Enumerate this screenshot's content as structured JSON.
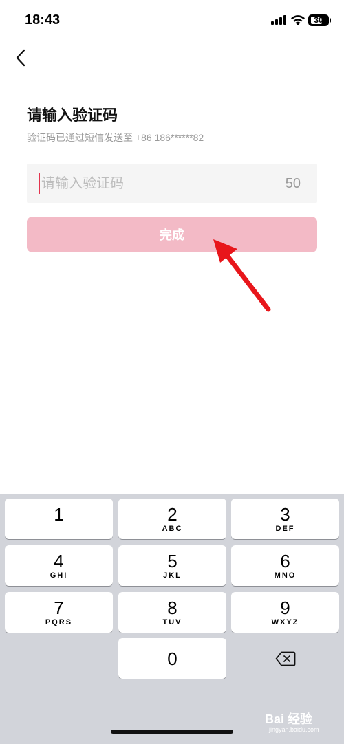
{
  "status_bar": {
    "time": "18:43",
    "battery": "30"
  },
  "header": {
    "title": "请输入验证码",
    "subtitle": "验证码已通过短信发送至 +86 186******82"
  },
  "code_input": {
    "placeholder": "请输入验证码",
    "value": "",
    "countdown": "50"
  },
  "done_button": {
    "label": "完成"
  },
  "colors": {
    "accent": "#e3344e",
    "button_disabled": "#f3bac6",
    "keyboard_bg": "#d2d4da",
    "annotation_arrow": "#e8161b"
  },
  "keyboard": {
    "keys": [
      {
        "digit": "1",
        "letters": ""
      },
      {
        "digit": "2",
        "letters": "ABC"
      },
      {
        "digit": "3",
        "letters": "DEF"
      },
      {
        "digit": "4",
        "letters": "GHI"
      },
      {
        "digit": "5",
        "letters": "JKL"
      },
      {
        "digit": "6",
        "letters": "MNO"
      },
      {
        "digit": "7",
        "letters": "PQRS"
      },
      {
        "digit": "8",
        "letters": "TUV"
      },
      {
        "digit": "9",
        "letters": "WXYZ"
      },
      {
        "digit": "0",
        "letters": ""
      }
    ],
    "delete_icon": "backspace-icon"
  },
  "watermark": {
    "brand": "Bai 经验",
    "site": "jingyan.baidu.com"
  }
}
